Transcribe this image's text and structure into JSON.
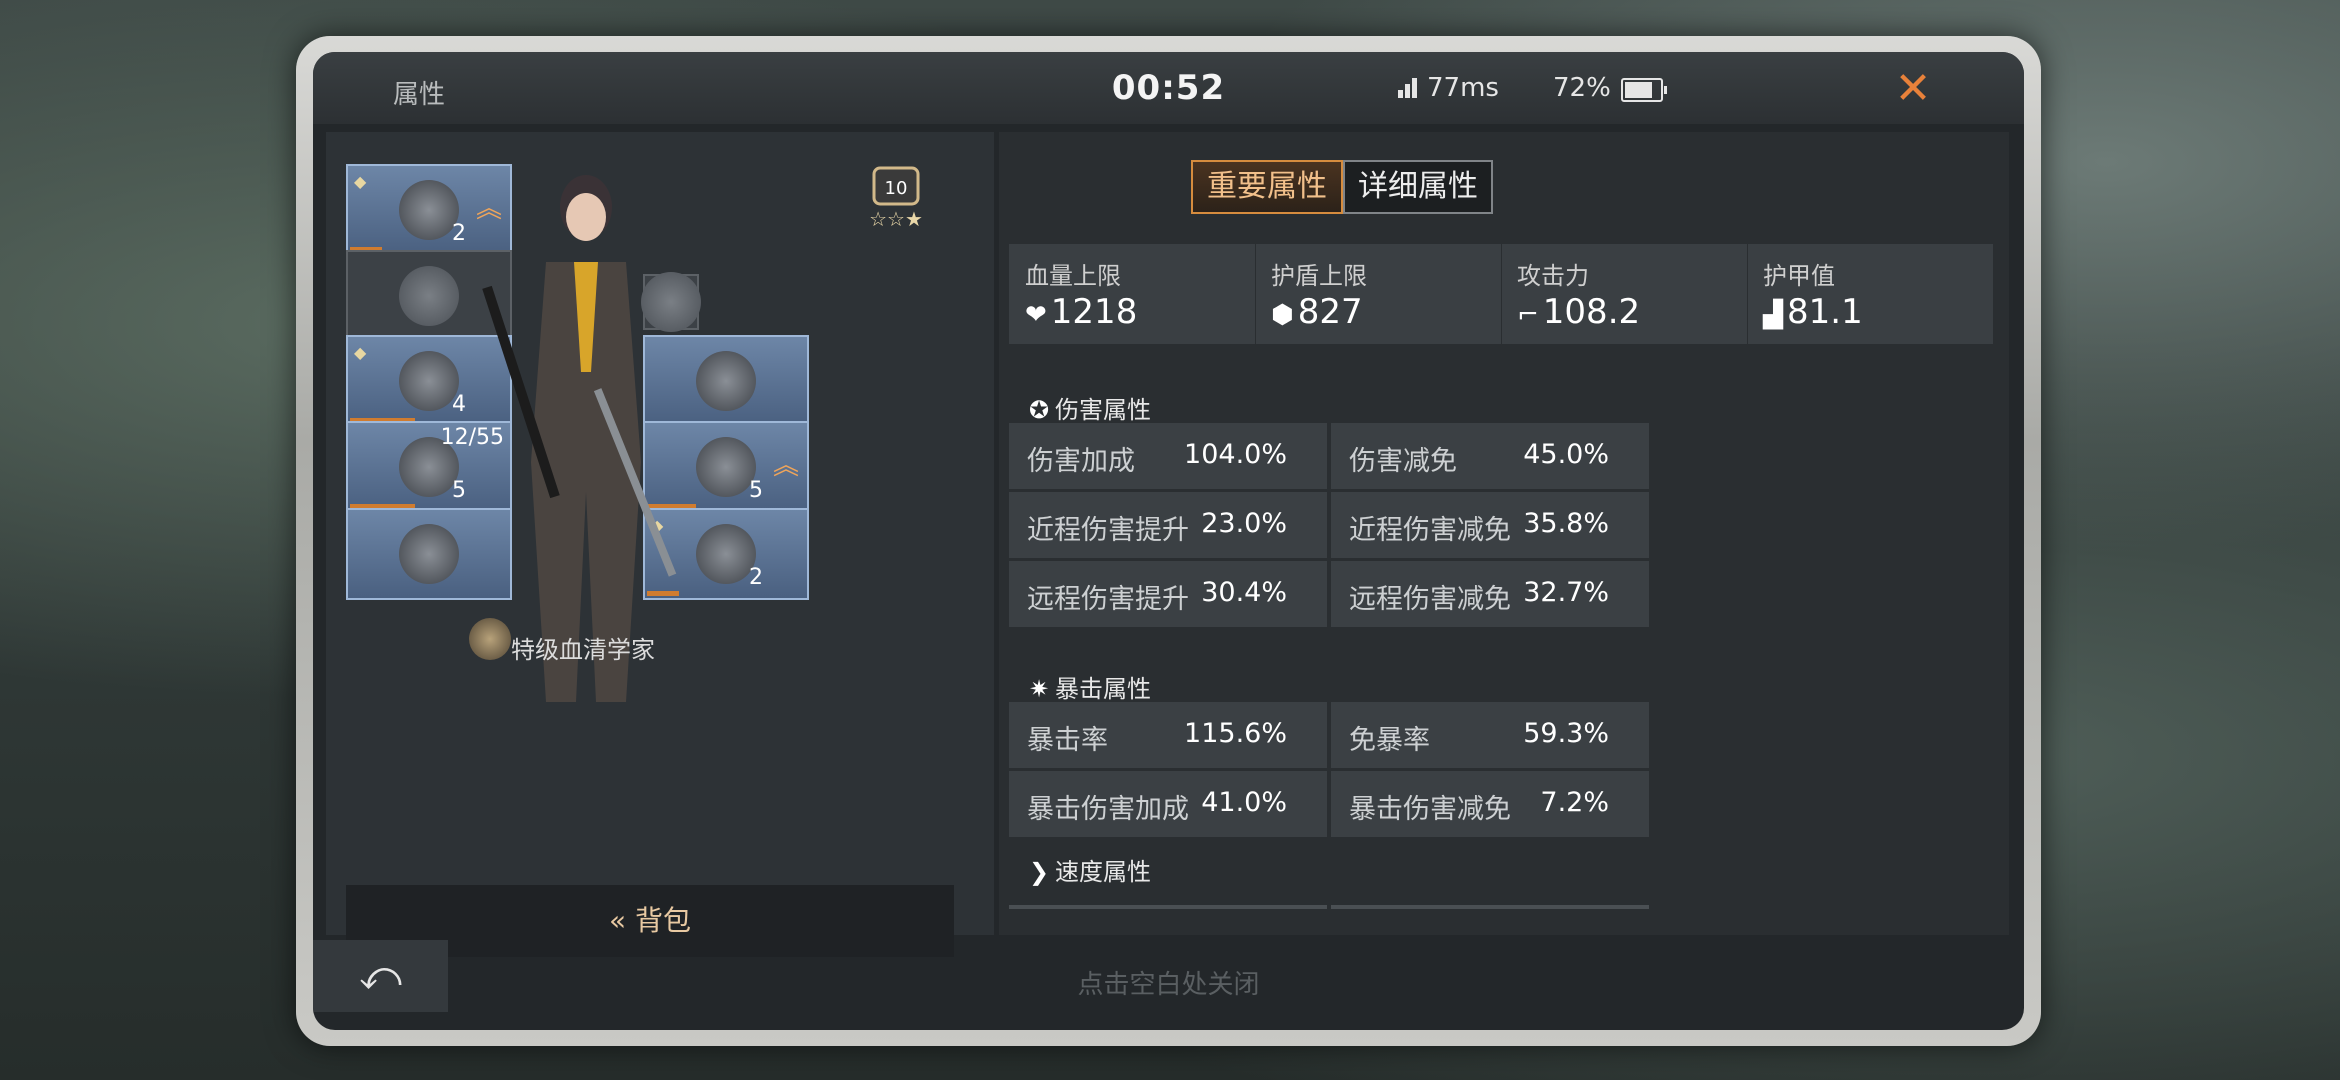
{
  "header": {
    "title": "属性",
    "timer": "00:52",
    "ping": "77ms",
    "battery": "72%",
    "battery_level": 0.72
  },
  "left": {
    "slots_left": [
      {
        "name": "hero-slot",
        "count": "",
        "level": "2",
        "bar": 0.2,
        "gem": true,
        "upgrade": true
      },
      {
        "name": "backpack-slot",
        "empty": true
      },
      {
        "name": "helmet-slot",
        "count": "",
        "level": "4",
        "bar": 0.4,
        "gem": true,
        "upgrade": false
      },
      {
        "name": "weapon-slot-1",
        "count": "12/55",
        "level": "5",
        "bar": 0.4,
        "gem": false,
        "upgrade": false
      },
      {
        "name": "pet-slot",
        "count": "",
        "level": "",
        "bar": 0,
        "gem": false,
        "upgrade": false
      }
    ],
    "slots_right": [
      {
        "name": "ring-slot-empty",
        "empty": true
      },
      {
        "name": "bracelet-slot",
        "count": "",
        "level": "",
        "bar": 0,
        "gem": false,
        "upgrade": false
      },
      {
        "name": "melee-weapon-slot",
        "count": "",
        "level": "5",
        "bar": 0.3,
        "gem": false,
        "upgrade": true
      },
      {
        "name": "armor-slot",
        "count": "",
        "level": "2",
        "bar": 0.2,
        "gem": true,
        "upgrade": false
      }
    ],
    "rank_level": "10",
    "character_name": "特级血清学家",
    "bag_label": "背包",
    "bag_icon": "«"
  },
  "right": {
    "tabs": {
      "active": "重要属性",
      "inactive": "详细属性"
    },
    "summary": [
      {
        "label": "血量上限",
        "icon": "heart-icon",
        "glyph": "❤",
        "value": "1218"
      },
      {
        "label": "护盾上限",
        "icon": "shield-icon",
        "glyph": "⬢",
        "value": "827"
      },
      {
        "label": "攻击力",
        "icon": "gun-icon",
        "glyph": "⌐",
        "value": "108.2"
      },
      {
        "label": "护甲值",
        "icon": "armor-icon",
        "glyph": "▟",
        "value": "81.1"
      }
    ],
    "sections": [
      {
        "title": "伤害属性",
        "rows": [
          [
            {
              "k": "伤害加成",
              "v": "104.0%"
            },
            {
              "k": "伤害减免",
              "v": "45.0%"
            }
          ],
          [
            {
              "k": "近程伤害提升",
              "v": "23.0%"
            },
            {
              "k": "近程伤害减免",
              "v": "35.8%"
            }
          ],
          [
            {
              "k": "远程伤害提升",
              "v": "30.4%"
            },
            {
              "k": "远程伤害减免",
              "v": "32.7%"
            }
          ]
        ]
      },
      {
        "title": "暴击属性",
        "rows": [
          [
            {
              "k": "暴击率",
              "v": "115.6%"
            },
            {
              "k": "免暴率",
              "v": "59.3%"
            }
          ],
          [
            {
              "k": "暴击伤害加成",
              "v": "41.0%"
            },
            {
              "k": "暴击伤害减免",
              "v": "7.2%"
            }
          ]
        ]
      },
      {
        "title": "速度属性",
        "rows": []
      }
    ]
  },
  "footer": {
    "hint": "点击空白处关闭",
    "back_icon": "⤺"
  },
  "colors": {
    "accent": "#e8813a",
    "slot_blue": "#6d86a7"
  }
}
